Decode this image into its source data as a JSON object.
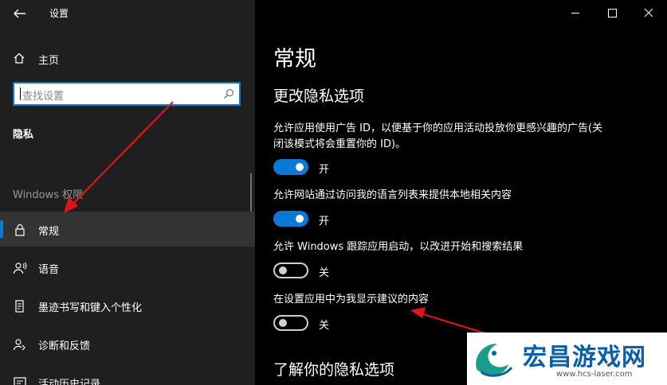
{
  "window": {
    "title": "设置"
  },
  "sidebar": {
    "home_label": "主页",
    "search_placeholder": "查找设置",
    "section_label": "隐私",
    "group_label": "Windows 权限",
    "items": [
      {
        "label": "常规",
        "icon": "lock-icon",
        "selected": true
      },
      {
        "label": "语音",
        "icon": "speech-icon",
        "selected": false
      },
      {
        "label": "墨迹书写和键入个性化",
        "icon": "inking-icon",
        "selected": false
      },
      {
        "label": "诊断和反馈",
        "icon": "diagnostics-icon",
        "selected": false
      },
      {
        "label": "活动历史记录",
        "icon": "activity-history-icon",
        "selected": false
      }
    ]
  },
  "main": {
    "page_title": "常规",
    "section_title": "更改隐私选项",
    "options": [
      {
        "line1": "允许应用使用广告 ID，以便基于你的应用活动投放你更感兴趣的广告(关",
        "line2": "闭该模式将会重置你的 ID)。",
        "state": "开",
        "on": true
      },
      {
        "line1": "允许网站通过访问我的语言列表来提供本地相关内容",
        "state": "开",
        "on": true
      },
      {
        "line1": "允许 Windows 跟踪应用启动，以改进开始和搜索结果",
        "state": "关",
        "on": false
      },
      {
        "line1": "在设置应用中为我显示建议的内容",
        "state": "关",
        "on": false
      }
    ],
    "learn_more_title": "了解你的隐私选项"
  },
  "watermark": {
    "title": "宏昌游戏网",
    "url": "www.hcs-laser.com"
  },
  "colors": {
    "accent": "#0a78d4",
    "sidebar_bg": "#1f1f1f",
    "main_bg": "#000000",
    "annotation_arrow": "#e0141b"
  }
}
